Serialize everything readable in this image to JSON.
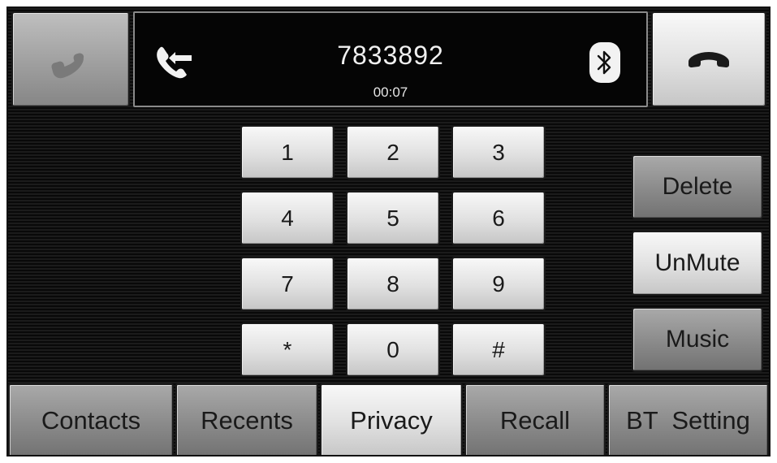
{
  "call": {
    "number": "7833892",
    "duration": "00:07",
    "answer_icon": "phone-handset-icon",
    "status_icon": "outgoing-call-icon",
    "bluetooth_icon": "bluetooth-icon",
    "hangup_icon": "hang-up-icon"
  },
  "keypad": {
    "keys": [
      "1",
      "2",
      "3",
      "4",
      "5",
      "6",
      "7",
      "8",
      "9",
      "*",
      "0",
      "#"
    ]
  },
  "side_buttons": {
    "delete": "Delete",
    "unmute": "UnMute",
    "music": "Music"
  },
  "tabs": {
    "contacts": "Contacts",
    "recents": "Recents",
    "privacy": "Privacy",
    "recall": "Recall",
    "bt_setting": "BT  Setting"
  },
  "colors": {
    "screen_bg": "#0c0c0c",
    "button_light": "#e6e6e6",
    "button_dark": "#8e8e8e",
    "display_text": "#f0f0f0"
  }
}
